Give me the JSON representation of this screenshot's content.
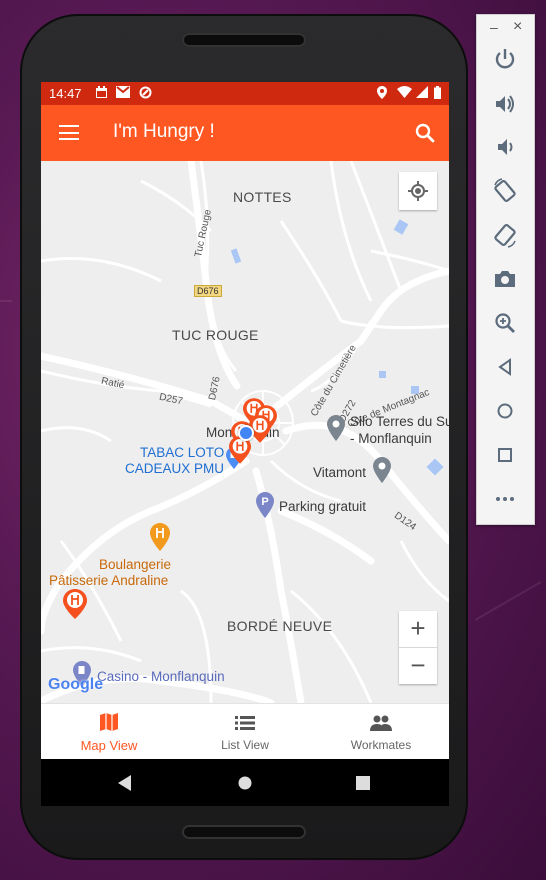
{
  "status_bar": {
    "time": "14:47"
  },
  "app_bar": {
    "title": "I'm Hungry !"
  },
  "map": {
    "labels": {
      "nottes": "NOTTES",
      "tuc_rouge": "TUC ROUGE",
      "borde_neuve": "BORDÉ NEUVE",
      "monflanquin": "Monflanquin",
      "tabac_line1": "TABAC LOTO",
      "tabac_line2": "CADEAUX PMU",
      "parking": "Parking gratuit",
      "vitamont": "Vitamont",
      "silo_line1": "Silo Terres du Sud",
      "silo_line2": "- Monflanquin",
      "boulangerie_line1": "Boulangerie",
      "boulangerie_line2": "Pâtisserie Andraline",
      "casino": "Casino - Monflanquin",
      "road_d676_badge": "D676",
      "road_d676": "D676",
      "road_d257": "D257",
      "road_d272": "D272",
      "road_d124": "D124",
      "road_tuc_rouge": "Tuc Rouge",
      "road_ratie": "Ratié",
      "road_cimetiere": "Côte du Cimetière",
      "road_montagnac": "Côte de Montagnac",
      "google": "Google"
    },
    "zoom_in": "+",
    "zoom_out": "−"
  },
  "bottom_nav": {
    "items": [
      {
        "label": "Map View",
        "icon": "map-icon",
        "active": true
      },
      {
        "label": "List View",
        "icon": "list-icon",
        "active": false
      },
      {
        "label": "Workmates",
        "icon": "people-icon",
        "active": false
      }
    ]
  },
  "emulator_panel": {
    "minimize": "–",
    "close": "×"
  },
  "colors": {
    "status_bar": "#cf2a10",
    "app_bar": "#fe5722",
    "accent": "#fe5722",
    "marker": "#f4511e",
    "location_dot": "#4285f4"
  }
}
